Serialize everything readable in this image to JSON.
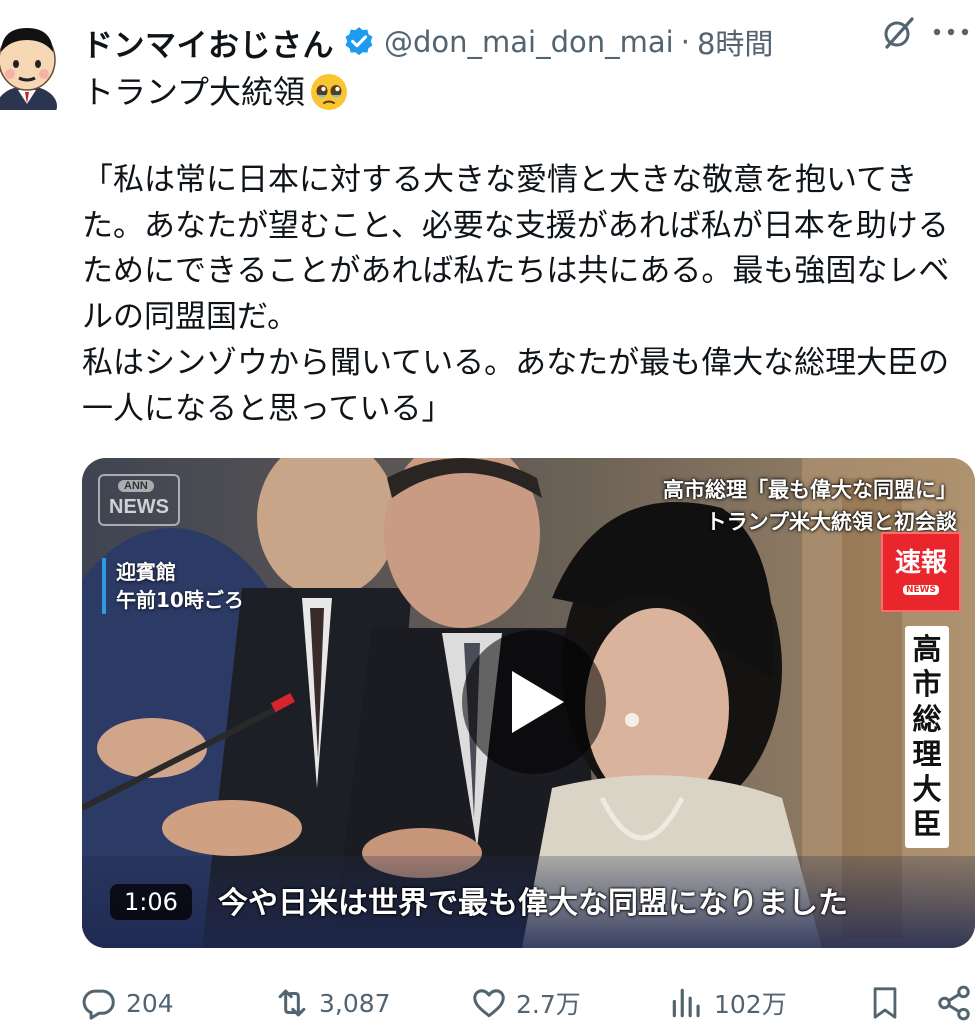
{
  "post": {
    "author_name": "ドンマイおじさん",
    "handle": "@don_mai_don_mai",
    "separator": "·",
    "time": "8時間",
    "title": "トランプ大統領",
    "title_emoji": "pleading-face-emoji",
    "body": "「私は常に日本に対する大きな愛情と大きな敬意を抱いてきた。あなたが望むこと、必要な支援があれば私が日本を助けるためにできることがあれば私たちは共にある。最も強固なレベルの同盟国だ。\n私はシンゾウから聞いている。あなたが最も偉大な総理大臣の一人になると思っている」"
  },
  "video": {
    "logo_small": "ANN",
    "logo": "NEWS",
    "location_line1": "迎賓館",
    "location_line2": "午前10時ごろ",
    "headline_line1": "高市総理「最も偉大な同盟に」",
    "headline_line2": "トランプ米大統領と初会談",
    "breaking": "速報",
    "breaking_sub": "NEWS",
    "vertical_caption": "高市総理大臣",
    "subtitle": "今や日米は世界で最も偉大な同盟になりました",
    "duration": "1:06"
  },
  "actions": {
    "replies": "204",
    "reposts": "3,087",
    "likes": "2.7万",
    "views": "102万"
  },
  "colors": {
    "verified": "#1d9bf0",
    "muted": "#536471",
    "breaking_red": "#e8262b"
  }
}
